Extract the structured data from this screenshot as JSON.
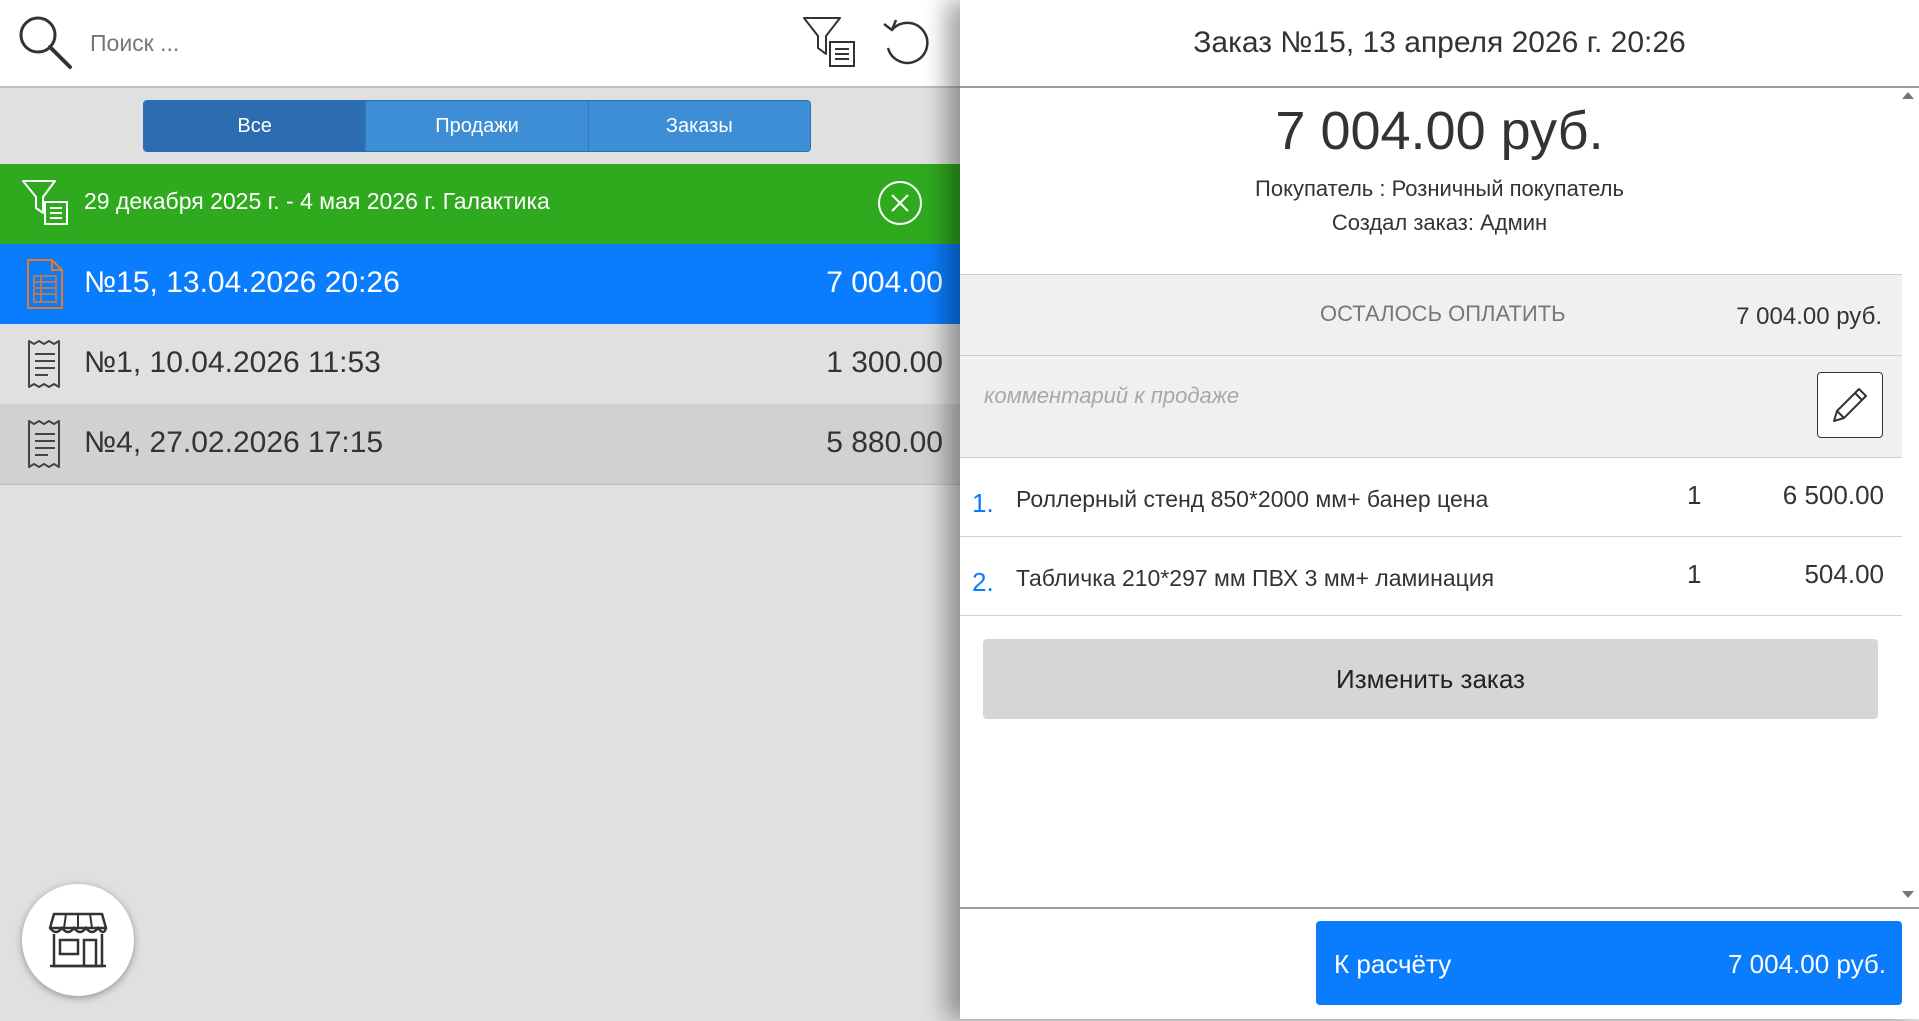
{
  "search": {
    "placeholder": "Поиск ..."
  },
  "tabs": [
    {
      "label": "Все",
      "active": true
    },
    {
      "label": "Продажи",
      "active": false
    },
    {
      "label": "Заказы",
      "active": false
    }
  ],
  "filter": {
    "text": "29 декабря 2025 г. - 4 мая 2026 г. Галактика"
  },
  "list": [
    {
      "title": "№15, 13.04.2026 20:26",
      "amount": "7 004.00",
      "selected": true,
      "icon": "order-doc-icon"
    },
    {
      "title": "№1, 10.04.2026 11:53",
      "amount": "1 300.00",
      "selected": false,
      "icon": "receipt-icon"
    },
    {
      "title": "№4, 27.02.2026 17:15",
      "amount": "5 880.00",
      "selected": false,
      "icon": "receipt-icon"
    }
  ],
  "order": {
    "title": "Заказ №15, 13 апреля 2026 г. 20:26",
    "total": "7 004.00 руб.",
    "buyer": "Покупатель : Розничный покупатель",
    "creator": "Создал заказ: Админ",
    "remaining_label": "ОСТАЛОСЬ ОПЛАТИТЬ",
    "remaining_value": "7 004.00 руб.",
    "comment_placeholder": "комментарий к продаже",
    "items": [
      {
        "num": "1.",
        "name": "Роллерный стенд 850*2000 мм+ банер цена",
        "qty": "1",
        "price": "6 500.00"
      },
      {
        "num": "2.",
        "name": "Табличка 210*297 мм ПВХ 3 мм+ ламинация",
        "qty": "1",
        "price": "504.00"
      }
    ],
    "edit_button": "Изменить заказ",
    "pay_button": {
      "label": "К расчёту",
      "amount": "7 004.00 руб."
    }
  },
  "colors": {
    "accent_blue": "#0a7dff",
    "filter_green": "#2faa1e",
    "tab_blue": "#3e8ed6",
    "tab_active": "#2b6db0"
  }
}
